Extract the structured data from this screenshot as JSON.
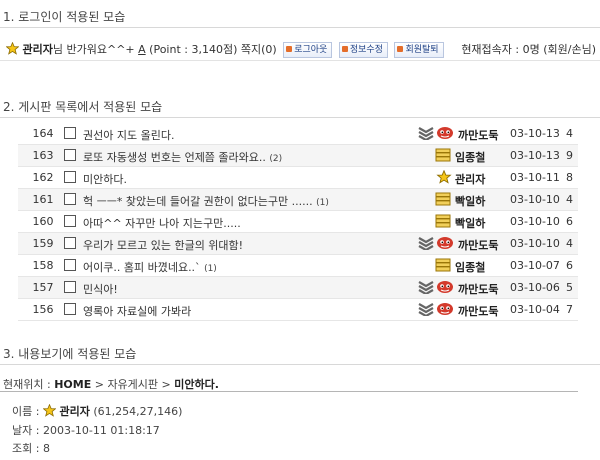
{
  "sections": {
    "s1": "1. 로그인이 적용된 모습",
    "s2": "2. 게시판 목록에서 적용된 모습",
    "s3": "3. 내용보기에 적용된 모습"
  },
  "login": {
    "name": "관리자",
    "greeting": "님 반가워요^^+",
    "point_letter": "A",
    "point_text": "(Point : 3,140점)",
    "memo": "쪽지(0)",
    "logout": "로그아웃",
    "edit_info": "정보수정",
    "withdraw": "회원탈퇴",
    "online": "현재접속자 : 0명 (회원/손님)"
  },
  "board": {
    "rows": [
      {
        "num": "164",
        "subject": "권선아 지도 올린다.",
        "comments": "",
        "author": "까만도둑",
        "date": "03-10-13",
        "hits": "4",
        "rank": "gray"
      },
      {
        "num": "163",
        "subject": "로또 자동생성 번호는 언제쯤 졸라와요..",
        "comments": "(2)",
        "author": "임종철",
        "date": "03-10-13",
        "hits": "9",
        "rank": "gold"
      },
      {
        "num": "162",
        "subject": "미안하다.",
        "comments": "",
        "author": "관리자",
        "date": "03-10-11",
        "hits": "8",
        "rank": "star"
      },
      {
        "num": "161",
        "subject": "헉 ㅡㅡ* 찾았는데 들어갈 권한이 없다는구만 ......",
        "comments": "(1)",
        "author": "빡일하",
        "date": "03-10-10",
        "hits": "4",
        "rank": "gold"
      },
      {
        "num": "160",
        "subject": "아따^^ 자꾸만 나아 지는구만.....",
        "comments": "",
        "author": "빡일하",
        "date": "03-10-10",
        "hits": "6",
        "rank": "gold"
      },
      {
        "num": "159",
        "subject": "우리가 모르고 있는 한글의 위대함!",
        "comments": "",
        "author": "까만도둑",
        "date": "03-10-10",
        "hits": "4",
        "rank": "gray"
      },
      {
        "num": "158",
        "subject": "어이쿠.. 홈피 바꼈네요..`",
        "comments": "(1)",
        "author": "임종철",
        "date": "03-10-07",
        "hits": "6",
        "rank": "gold"
      },
      {
        "num": "157",
        "subject": "민식아!",
        "comments": "",
        "author": "까만도둑",
        "date": "03-10-06",
        "hits": "5",
        "rank": "gray"
      },
      {
        "num": "156",
        "subject": "영록아 자료실에 가봐라",
        "comments": "",
        "author": "까만도둑",
        "date": "03-10-04",
        "hits": "7",
        "rank": "gray"
      }
    ]
  },
  "view": {
    "location_label": "현재위치 :",
    "home": "HOME",
    "board_name": "자유게시판",
    "current": "미안하다.",
    "name_label": "이름 :",
    "name": "관리자",
    "ip": "(61,254,27,146)",
    "date_label": "날자 :",
    "date": "2003-10-11 01:18:17",
    "hits_label": "조회 :",
    "hits": "8"
  },
  "icons": {
    "star": "star-icon",
    "gold_rank": "gold-rank-icon",
    "gray_rank": "gray-rank-icon",
    "mascot": "mascot-icon"
  },
  "colors": {
    "gold": "#e3b52d",
    "gray": "#6a6a6a",
    "pill_text": "#224488",
    "mascot": "#d33a2c"
  }
}
